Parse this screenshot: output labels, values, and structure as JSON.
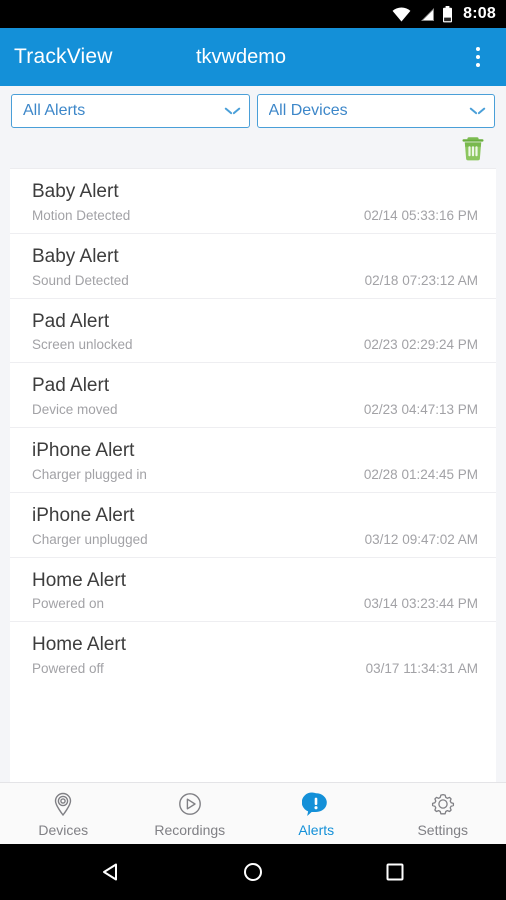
{
  "statusbar": {
    "time": "8:08",
    "icons": [
      "wifi-icon",
      "cellular-signal-icon",
      "battery-icon"
    ]
  },
  "appbar": {
    "title": "TrackView",
    "account": "tkvwdemo",
    "overflow_label": "more-options",
    "background_color": "#1490d8"
  },
  "filters": {
    "alert_filter": {
      "value": "All Alerts"
    },
    "device_filter": {
      "value": "All Devices"
    },
    "delete_label": "Delete all alerts",
    "delete_color": "#6aaf3f"
  },
  "alerts": [
    {
      "title": "Baby Alert",
      "description": "Motion Detected",
      "timestamp": "02/14 05:33:16 PM"
    },
    {
      "title": "Baby Alert",
      "description": "Sound Detected",
      "timestamp": "02/18 07:23:12 AM"
    },
    {
      "title": "Pad Alert",
      "description": "Screen unlocked",
      "timestamp": "02/23 02:29:24 PM"
    },
    {
      "title": "Pad Alert",
      "description": "Device moved",
      "timestamp": "02/23 04:47:13 PM"
    },
    {
      "title": "iPhone Alert",
      "description": "Charger plugged in",
      "timestamp": "02/28 01:24:45 PM"
    },
    {
      "title": "iPhone Alert",
      "description": "Charger unplugged",
      "timestamp": "03/12 09:47:02 AM"
    },
    {
      "title": "Home Alert",
      "description": "Powered on",
      "timestamp": "03/14 03:23:44 PM"
    },
    {
      "title": "Home Alert",
      "description": "Powered off",
      "timestamp": "03/17 11:34:31 AM"
    }
  ],
  "tabbar": {
    "active_color": "#1490d8",
    "inactive_color": "#808085",
    "tabs": [
      {
        "label": "Devices",
        "icon": "location-pin-icon",
        "active": false
      },
      {
        "label": "Recordings",
        "icon": "play-circle-icon",
        "active": false
      },
      {
        "label": "Alerts",
        "icon": "alert-bubble-icon",
        "active": true
      },
      {
        "label": "Settings",
        "icon": "gear-icon",
        "active": false
      }
    ]
  },
  "navbar": {
    "back": "back-triangle-icon",
    "home": "home-circle-icon",
    "recents": "recents-square-icon"
  }
}
